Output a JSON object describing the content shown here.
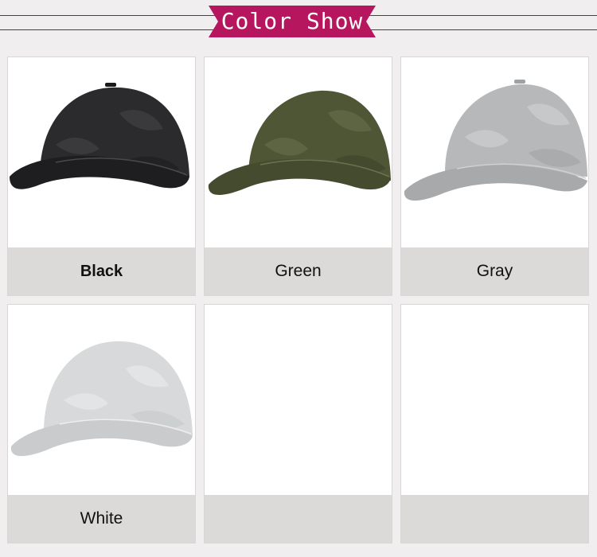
{
  "header": {
    "title": "Color Show",
    "accent_color": "#b5165e"
  },
  "colors": [
    {
      "label": "Black",
      "cap_color": "#2b2b2d"
    },
    {
      "label": "Green",
      "cap_color": "#4f5636"
    },
    {
      "label": "Gray",
      "cap_color": "#b6b8ba"
    },
    {
      "label": "White",
      "cap_color": "#d7d9da"
    },
    {
      "label": "",
      "cap_color": ""
    },
    {
      "label": "",
      "cap_color": ""
    }
  ]
}
